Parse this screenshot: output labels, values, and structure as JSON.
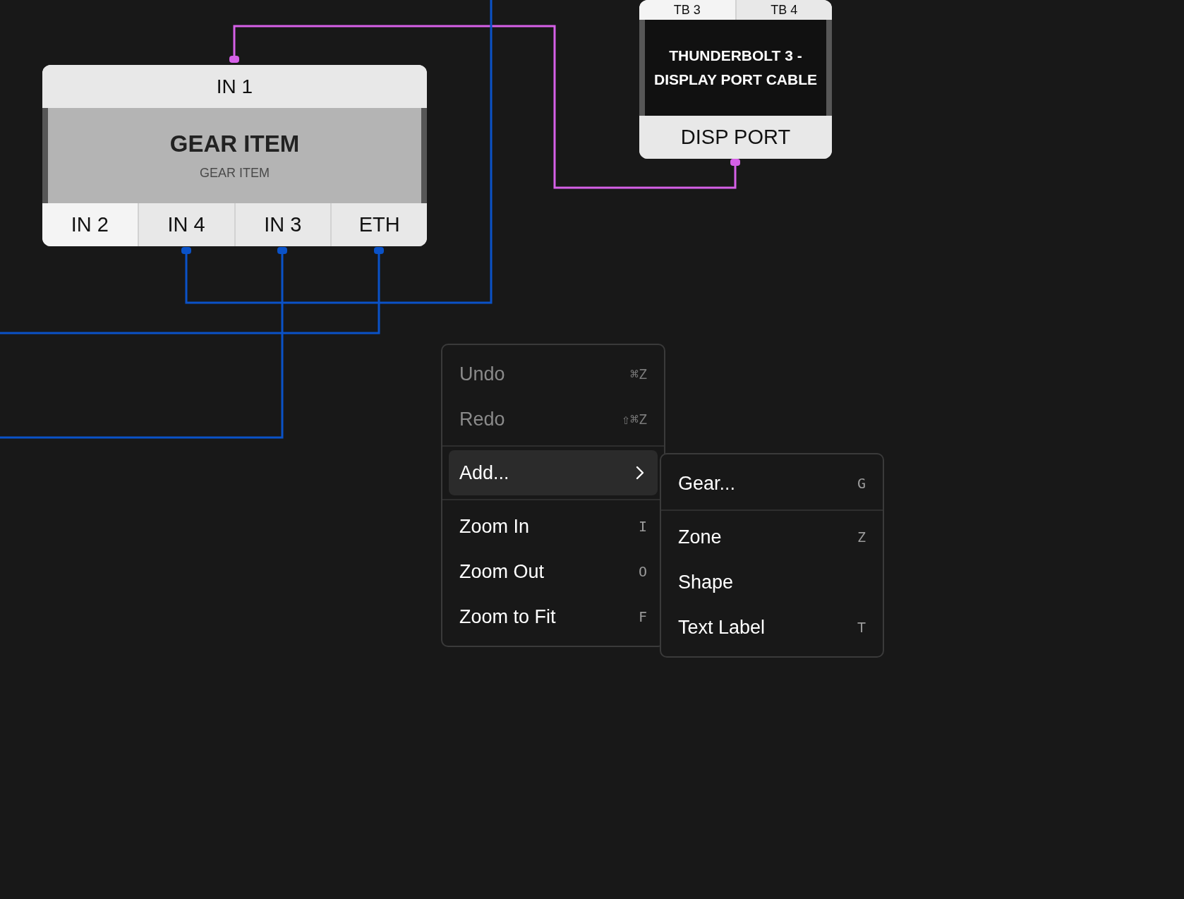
{
  "canvas": {
    "nodes": [
      {
        "kind": "gear",
        "title": "GEAR ITEM",
        "subtitle": "GEAR ITEM",
        "top_ports": [
          {
            "label": "IN 1",
            "selected": false
          }
        ],
        "bottom_ports": [
          {
            "label": "IN 2",
            "selected": true
          },
          {
            "label": "IN 4",
            "selected": false
          },
          {
            "label": "IN 3",
            "selected": false
          },
          {
            "label": "ETH",
            "selected": false
          }
        ]
      },
      {
        "kind": "cable",
        "title": "THUNDERBOLT 3 - DISPLAY PORT CABLE",
        "top_ports": [
          {
            "label": "TB 3",
            "selected": true
          },
          {
            "label": "TB 4",
            "selected": false
          }
        ],
        "bottom_ports": [
          {
            "label": "DISP PORT",
            "selected": false
          }
        ]
      }
    ],
    "wires": [
      {
        "color": "#d660e8"
      },
      {
        "color": "#0a52c8"
      },
      {
        "color": "#0a52c8"
      },
      {
        "color": "#0a52c8"
      }
    ]
  },
  "context_menu": {
    "groups": [
      [
        {
          "label": "Undo",
          "shortcut": "⌘Z",
          "disabled": true,
          "selected": false,
          "kind": "command"
        },
        {
          "label": "Redo",
          "shortcut": "⇧⌘Z",
          "disabled": true,
          "selected": false,
          "kind": "command"
        }
      ],
      [
        {
          "label": "Add...",
          "disabled": false,
          "selected": true,
          "kind": "submenu"
        }
      ],
      [
        {
          "label": "Zoom In",
          "shortcut": "I",
          "disabled": false,
          "selected": false,
          "kind": "command"
        },
        {
          "label": "Zoom Out",
          "shortcut": "O",
          "disabled": false,
          "selected": false,
          "kind": "command"
        },
        {
          "label": "Zoom to Fit",
          "shortcut": "F",
          "disabled": false,
          "selected": false,
          "kind": "command"
        }
      ]
    ],
    "submenu": {
      "groups": [
        [
          {
            "label": "Gear...",
            "shortcut": "G",
            "disabled": false,
            "selected": false
          }
        ],
        [
          {
            "label": "Zone",
            "shortcut": "Z",
            "disabled": false,
            "selected": false
          },
          {
            "label": "Shape",
            "disabled": false,
            "selected": false
          },
          {
            "label": "Text Label",
            "shortcut": "T",
            "disabled": false,
            "selected": false
          }
        ]
      ]
    }
  }
}
